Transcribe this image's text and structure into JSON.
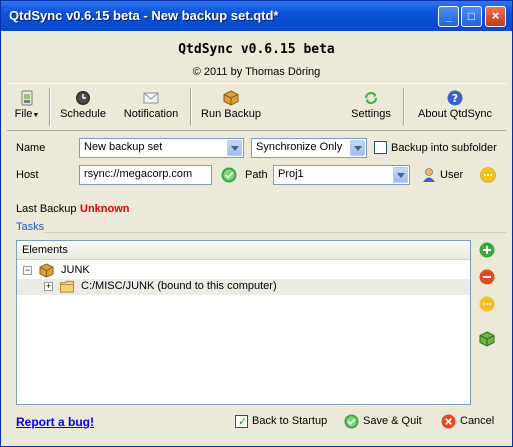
{
  "window": {
    "title": "QtdSync v0.6.15 beta - New backup set.qtd*",
    "controls": {
      "minimize": "_",
      "maximize": "□",
      "close": "×"
    }
  },
  "header": {
    "app_title": "QtdSync v0.6.15 beta",
    "copyright": "© 2011 by Thomas Döring"
  },
  "toolbar": {
    "file": "File",
    "schedule": "Schedule",
    "notification": "Notification",
    "run_backup": "Run Backup",
    "settings": "Settings",
    "about": "About QtdSync"
  },
  "form": {
    "name_label": "Name",
    "name_value": "New backup set",
    "mode_value": "Synchronize Only",
    "subfolder_label": "Backup into subfolder",
    "subfolder_checked": false,
    "host_label": "Host",
    "host_value": "rsync://megacorp.com",
    "path_label": "Path",
    "path_value": "Proj1",
    "user_label": "User"
  },
  "status": {
    "last_backup_label": "Last Backup",
    "last_backup_value": "Unknown",
    "last_backup_color": "#dd0000"
  },
  "tasks": {
    "label": "Tasks",
    "column_header": "Elements",
    "tree": [
      {
        "label": "JUNK",
        "expander": "−"
      },
      {
        "label": "C:/MISC/JUNK (bound to this computer)",
        "expander": "+"
      }
    ]
  },
  "side_buttons": [
    "add",
    "remove",
    "edit",
    "backup-package"
  ],
  "footer": {
    "report_bug": "Report a bug!",
    "back_to_startup": "Back to Startup",
    "back_to_startup_checked": true,
    "save_quit": "Save & Quit",
    "cancel": "Cancel"
  },
  "icons": {
    "file": "file-icon",
    "schedule": "clock-icon",
    "notification": "envelope-icon",
    "run_backup": "package-icon",
    "settings": "settings-arrows-icon",
    "about": "help-icon",
    "host_ok": "green-check-icon",
    "user": "user-icon",
    "user_edit": "more-options-icon"
  },
  "colors": {
    "titlebar": "#0a53d9",
    "accent_blue": "#003399",
    "green": "#3aa83a",
    "red": "#e04b1f",
    "yellow": "#f2c21b"
  }
}
